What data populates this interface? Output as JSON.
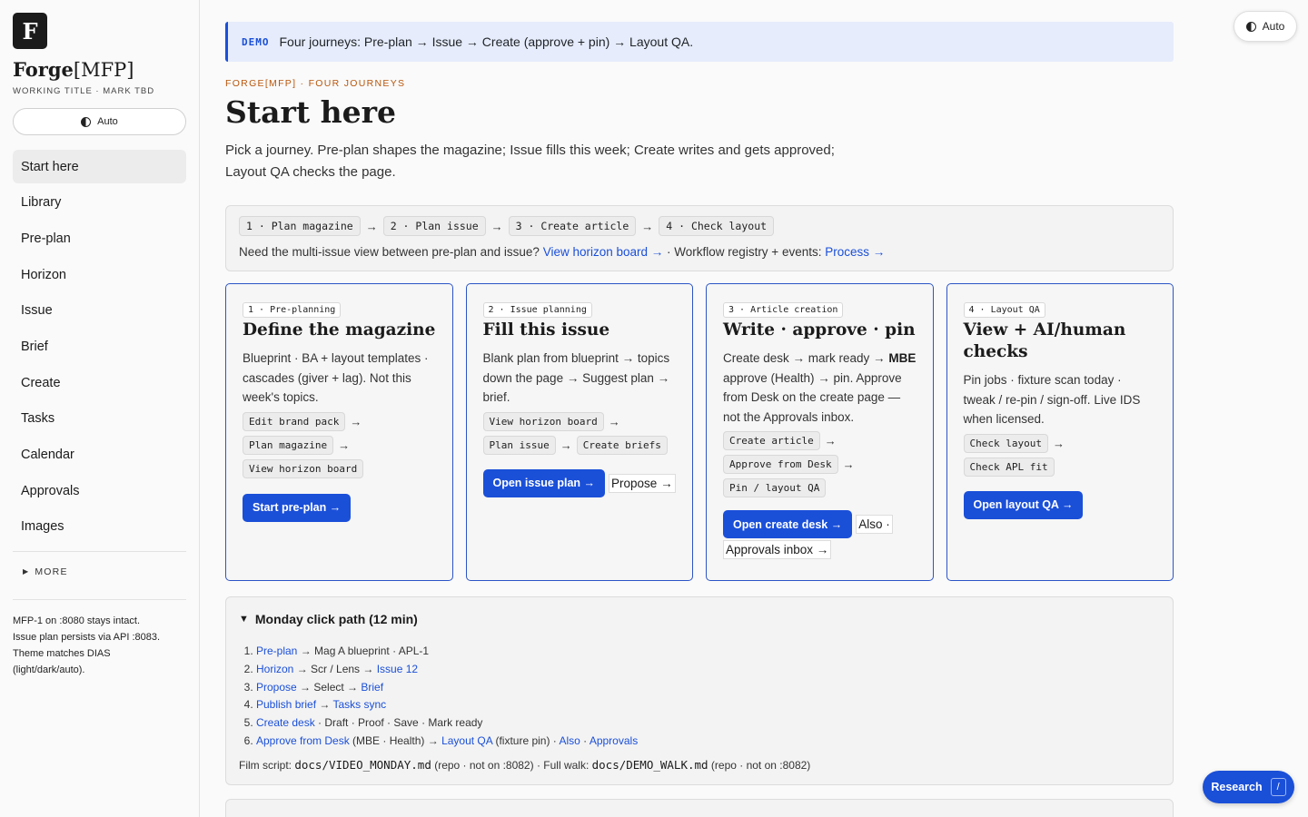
{
  "sidebar": {
    "logo_letter": "F",
    "brand_main": "Forge",
    "brand_suffix": "[MFP]",
    "brand_sub": "WORKING TITLE · MARK TBD",
    "theme_label": "Auto",
    "nav": [
      "Start here",
      "Library",
      "Pre-plan",
      "Horizon",
      "Issue",
      "Brief",
      "Create",
      "Tasks",
      "Calendar",
      "Approvals",
      "Images"
    ],
    "active_nav": "Start here",
    "more_label": "MORE",
    "note_lines": [
      "MFP-1 on :8080 stays intact.",
      "Issue plan persists via API :8083.",
      "Theme matches DIAS",
      "(light/dark/auto)."
    ]
  },
  "banner": {
    "tag": "DEMO",
    "text": "Four journeys: Pre-plan → Issue → Create (approve + pin) → Layout QA."
  },
  "header": {
    "eyebrow": "FORGE[MFP] · FOUR JOURNEYS",
    "title": "Start here",
    "lead_line1": "Pick a journey. Pre-plan shapes the magazine; Issue fills this week; Create writes and gets approved;",
    "lead_line2": "Layout QA checks the page."
  },
  "steps": {
    "chips": [
      "1 · Plan magazine",
      "2 · Plan issue",
      "3 · Create article",
      "4 · Check layout"
    ],
    "help_prefix": "Need the multi-issue view between pre-plan and issue?",
    "horizon_link": "View horizon board →",
    "help_middle": "· Workflow registry + events:",
    "process_link": "Process →"
  },
  "cards": [
    {
      "tag": "1 · Pre-planning",
      "title": "Define the magazine",
      "desc": "Blueprint · BA + layout templates · cascades (giver + lag). Not this week's topics.",
      "chips": [
        "Edit brand pack",
        "Plan magazine",
        "View horizon board"
      ],
      "button": "Start pre-plan →"
    },
    {
      "tag": "2 · Issue planning",
      "title": "Fill this issue",
      "desc": "Blank plan from blueprint → topics down the page → Suggest plan → brief.",
      "chips": [
        "View horizon board",
        "Plan issue",
        "Create briefs"
      ],
      "button": "Open issue plan →",
      "extra_link": "Propose →"
    },
    {
      "tag": "3 · Article creation",
      "title": "Write · approve · pin",
      "desc_a": "Create desk → mark ready →",
      "desc_bold": "MBE",
      "desc_b": "approve (Health) → pin. Approve from Desk on the create page — not the Approvals inbox.",
      "chips": [
        "Create article",
        "Approve from Desk",
        "Pin / layout QA"
      ],
      "button": "Open create desk →",
      "also_text": "Also ·",
      "also_link": "Approvals inbox →"
    },
    {
      "tag": "4 · Layout QA",
      "title": "View + AI/human checks",
      "desc": "Pin jobs · fixture scan today · tweak / re-pin / sign-off. Live IDS when licensed.",
      "chips": [
        "Check layout",
        "Check APL fit"
      ],
      "button": "Open layout QA →"
    }
  ],
  "click_path": {
    "summary": "Monday click path (12 min)",
    "items": [
      [
        {
          "link": "Pre-plan"
        },
        {
          "text": " → Mag A blueprint · APL-1"
        }
      ],
      [
        {
          "link": "Horizon"
        },
        {
          "text": " → Scr / Lens → "
        },
        {
          "link": "Issue 12"
        }
      ],
      [
        {
          "link": "Propose"
        },
        {
          "text": " → Select → "
        },
        {
          "link": "Brief"
        }
      ],
      [
        {
          "link": "Publish brief"
        },
        {
          "text": " → "
        },
        {
          "link": "Tasks sync"
        }
      ],
      [
        {
          "link": "Create desk"
        },
        {
          "text": " · Draft · Proof · Save · Mark ready"
        }
      ],
      [
        {
          "link": "Approve from Desk"
        },
        {
          "text": " (MBE · Health) → "
        },
        {
          "link": "Layout QA"
        },
        {
          "text": " (fixture pin) · "
        },
        {
          "link": "Also"
        },
        {
          "text": " · "
        },
        {
          "link": "Approvals"
        }
      ]
    ],
    "film_prefix": "Film script:",
    "film_file1": "docs/VIDEO_MONDAY.md",
    "film_mid": "(repo · not on :8082) · Full walk:",
    "film_file2": "docs/DEMO_WALK.md",
    "film_suffix": "(repo · not on :8082)"
  },
  "floating": {
    "theme_label": "Auto",
    "research_label": "Research",
    "research_key": "/"
  }
}
